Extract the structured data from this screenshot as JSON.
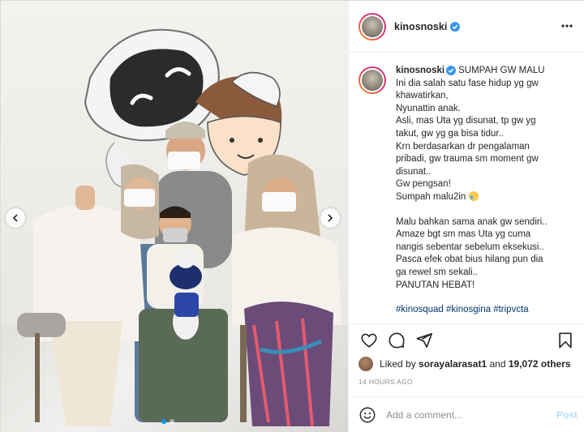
{
  "post": {
    "username": "kinosnoski",
    "verified": true
  },
  "caption": {
    "username": "kinosnoski",
    "lines": [
      "SUMPAH GW MALU",
      "Ini dia salah satu fase hidup yg gw",
      "khawatirkan,",
      "Nyunattin anak.",
      "Asli, mas Uta yg disunat, tp gw yg",
      "takut, gw yg ga bisa tidur..",
      "Krn berdasarkan dr pengalaman",
      "pribadi, gw trauma sm moment gw",
      "disunat..",
      "Gw pengsan!",
      "Sumpah malu2in",
      "",
      "Malu bahkan sama anak gw sendiri..",
      "Amaze bgt sm mas Uta yg cuma",
      "nangis sebentar sebelum eksekusi..",
      "Pasca efek obat bius hilang pun dia",
      "ga rewel sm sekali..",
      "PANUTAN HEBAT!",
      ""
    ],
    "hashtags": "#kinosquad #kinosgina #tripvcta"
  },
  "likes": {
    "prefix": "Liked by ",
    "user": "sorayalarasat1",
    "middle": " and ",
    "count": "19,072 others"
  },
  "timestamp": "14 HOURS AGO",
  "comment": {
    "placeholder": "Add a comment...",
    "post_label": "Post"
  },
  "carousel": {
    "slides": 2,
    "active_index": 0
  },
  "colors": {
    "accent": "#0095f6",
    "verified": "#3897f0",
    "hashtag": "#00376b",
    "muted": "#8e8e8e",
    "post_disabled": "#b2dffc"
  },
  "icons": {
    "photo_prev": "chevron-left-icon",
    "photo_next": "chevron-right-icon",
    "more": "more-horizontal-icon",
    "like": "heart-icon",
    "comment": "comment-bubble-icon",
    "share": "paper-plane-icon",
    "save": "bookmark-icon",
    "emoji": "smiley-icon",
    "verified": "verified-badge-icon"
  }
}
